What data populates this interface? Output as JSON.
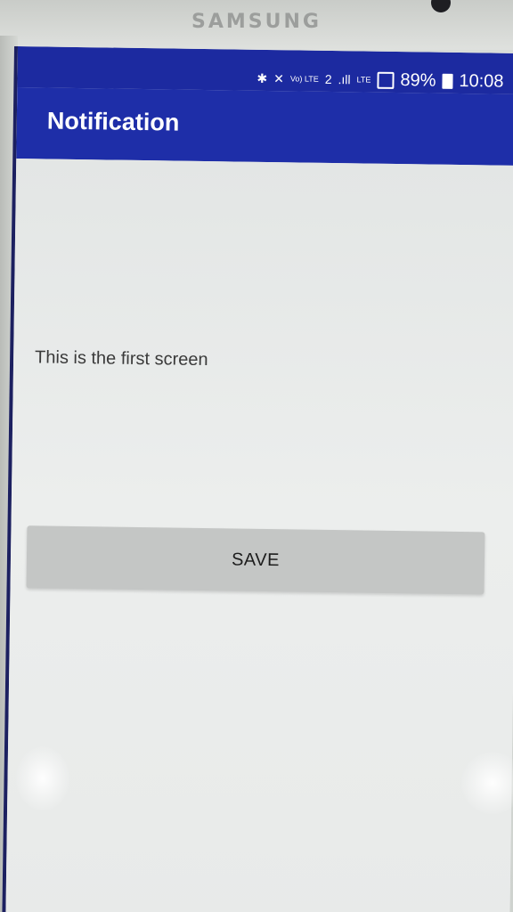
{
  "device": {
    "brand": "SAMSUNG"
  },
  "status_bar": {
    "icons": [
      "bluetooth-icon",
      "mute-icon",
      "volte-icon",
      "sim-2-icon",
      "signal-icon",
      "lte-icon",
      "screen-box-icon",
      "battery-icon"
    ],
    "volte_text": "Vo) LTE",
    "sim_slot": "2",
    "signal_text": ".ıll",
    "lte_text": "LTE",
    "battery": "89%",
    "time": "10:08"
  },
  "app_bar": {
    "title": "Notification",
    "color": "#1e2ea8"
  },
  "main": {
    "message": "This is the first screen",
    "save_label": "SAVE"
  }
}
